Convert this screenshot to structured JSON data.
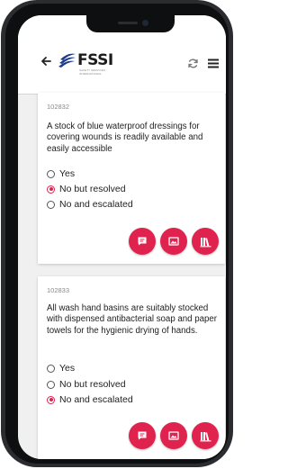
{
  "header": {
    "logo_text": "FSSI",
    "logo_tagline": "SAFETY SERVICES INTERNATIONAL",
    "back_icon": "arrow-left-icon",
    "refresh_icon": "refresh-icon",
    "menu_icon": "menu-icon"
  },
  "colors": {
    "accent": "#e0234e",
    "background": "#f0f0f0",
    "card": "#ffffff"
  },
  "questions": [
    {
      "code": "102832",
      "text": "A stock of blue waterproof dressings for covering wounds is readily available and easily accessible",
      "options": [
        "Yes",
        "No but resolved",
        "No and escalated"
      ],
      "selected": "No but resolved",
      "actions": [
        "comment-icon",
        "image-icon",
        "library-icon"
      ]
    },
    {
      "code": "102833",
      "text": "All wash hand basins are suitably stocked with dispensed antibacterial soap and paper towels for the hygienic drying of hands.",
      "options": [
        "Yes",
        "No but resolved",
        "No and escalated"
      ],
      "selected": "No and escalated",
      "actions": [
        "comment-icon",
        "image-icon",
        "library-icon"
      ]
    }
  ]
}
